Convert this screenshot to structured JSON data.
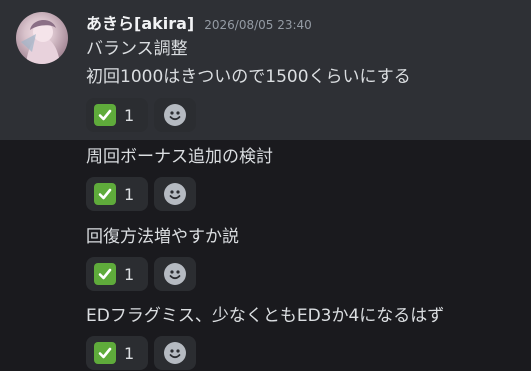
{
  "message": {
    "username": "あきら[akira]",
    "timestamp": "2026/08/05 23:40"
  },
  "lines": [
    "バランス調整",
    "初回1000はきついので1500くらいにする",
    "周回ボーナス追加の検討",
    "回復方法増やすか説",
    "EDフラグミス、少なくともED3か4になるはず"
  ],
  "reactions": {
    "emoji": "white-check-mark",
    "check_count": "1",
    "add_reaction_icon": "smiley-icon"
  },
  "colors": {
    "background": "#1a1a1e",
    "highlight": "#2e3035",
    "check_green": "#5fab3b",
    "text": "#dbdee1",
    "timestamp": "#949ba4"
  }
}
